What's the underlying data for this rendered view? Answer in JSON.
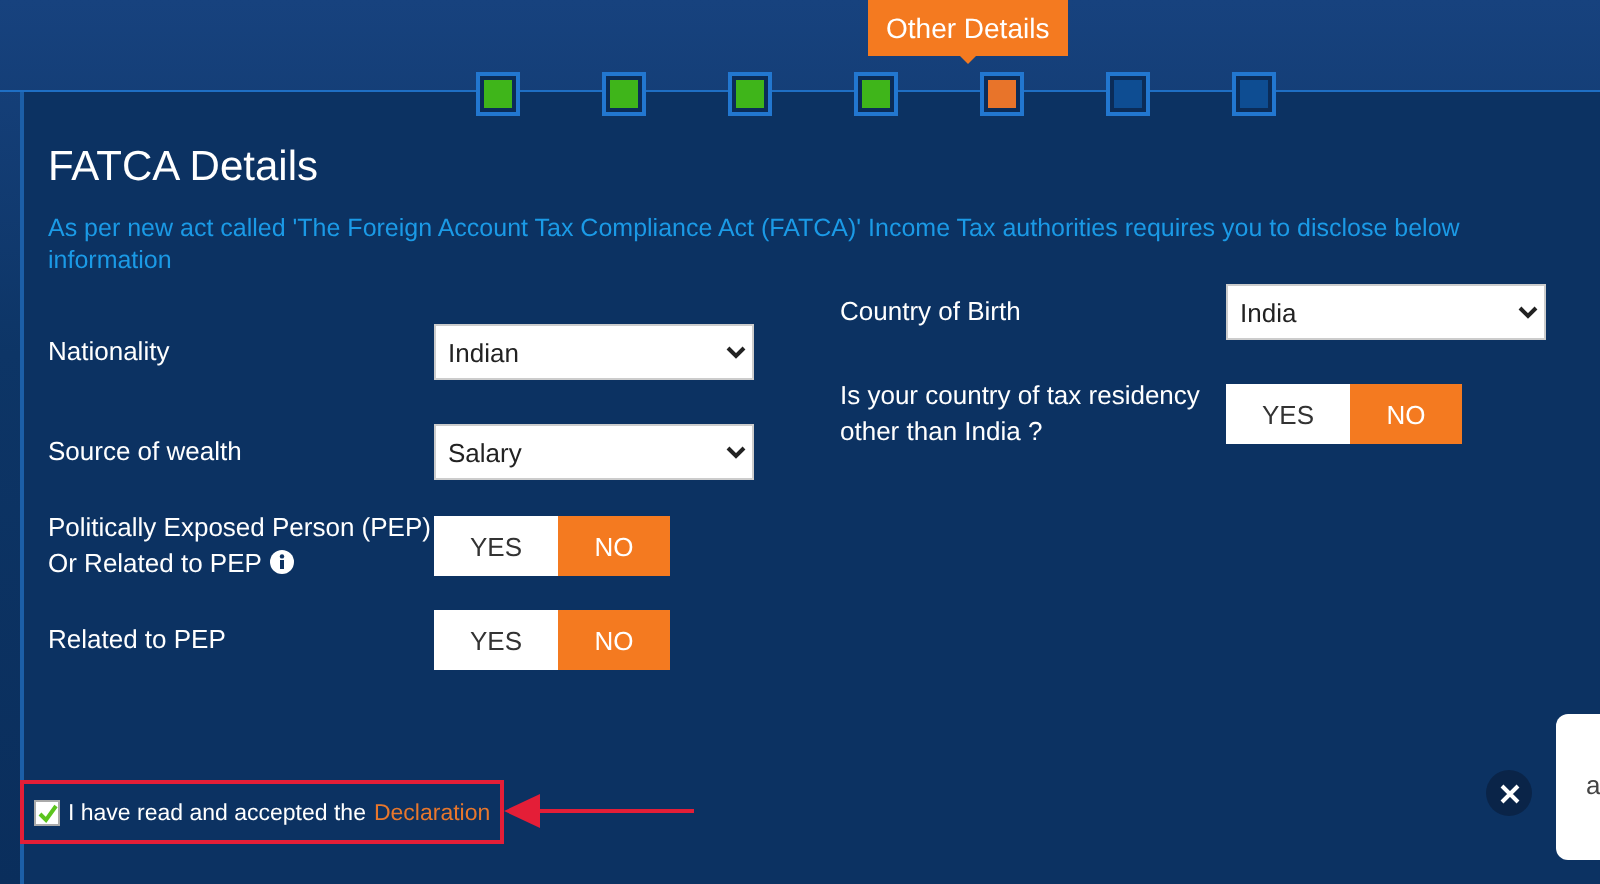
{
  "progress": {
    "tooltip": "Other Details",
    "steps": [
      {
        "kind": "done"
      },
      {
        "kind": "done"
      },
      {
        "kind": "done"
      },
      {
        "kind": "done"
      },
      {
        "kind": "current"
      },
      {
        "kind": "pending"
      },
      {
        "kind": "pending"
      }
    ]
  },
  "section": {
    "title": "FATCA Details",
    "description": "As per new act called 'The Foreign Account Tax Compliance Act (FATCA)' Income Tax authorities requires you to disclose below information"
  },
  "left_fields": [
    {
      "kind": "select",
      "label": "Nationality",
      "value": "Indian"
    },
    {
      "kind": "select",
      "label": "Source of wealth",
      "value": "Salary"
    },
    {
      "kind": "toggle",
      "label": "Politically Exposed Person (PEP) Or Related to PEP",
      "info": true,
      "options": [
        {
          "label": "YES",
          "selected": false
        },
        {
          "label": "NO",
          "selected": true
        }
      ]
    },
    {
      "kind": "toggle",
      "label": "Related to PEP",
      "info": false,
      "options": [
        {
          "label": "YES",
          "selected": false
        },
        {
          "label": "NO",
          "selected": true
        }
      ]
    }
  ],
  "right_fields": [
    {
      "kind": "select",
      "label": "Country of Birth",
      "value": "India"
    },
    {
      "kind": "toggle",
      "label": "Is your country of tax residency other than India ?",
      "info": false,
      "options": [
        {
          "label": "YES",
          "selected": false
        },
        {
          "label": "NO",
          "selected": true
        }
      ]
    }
  ],
  "declaration": {
    "checked": true,
    "text": "I have read and accepted the",
    "link": "Declaration"
  },
  "chat": {
    "lines": [
      "a"
    ]
  }
}
